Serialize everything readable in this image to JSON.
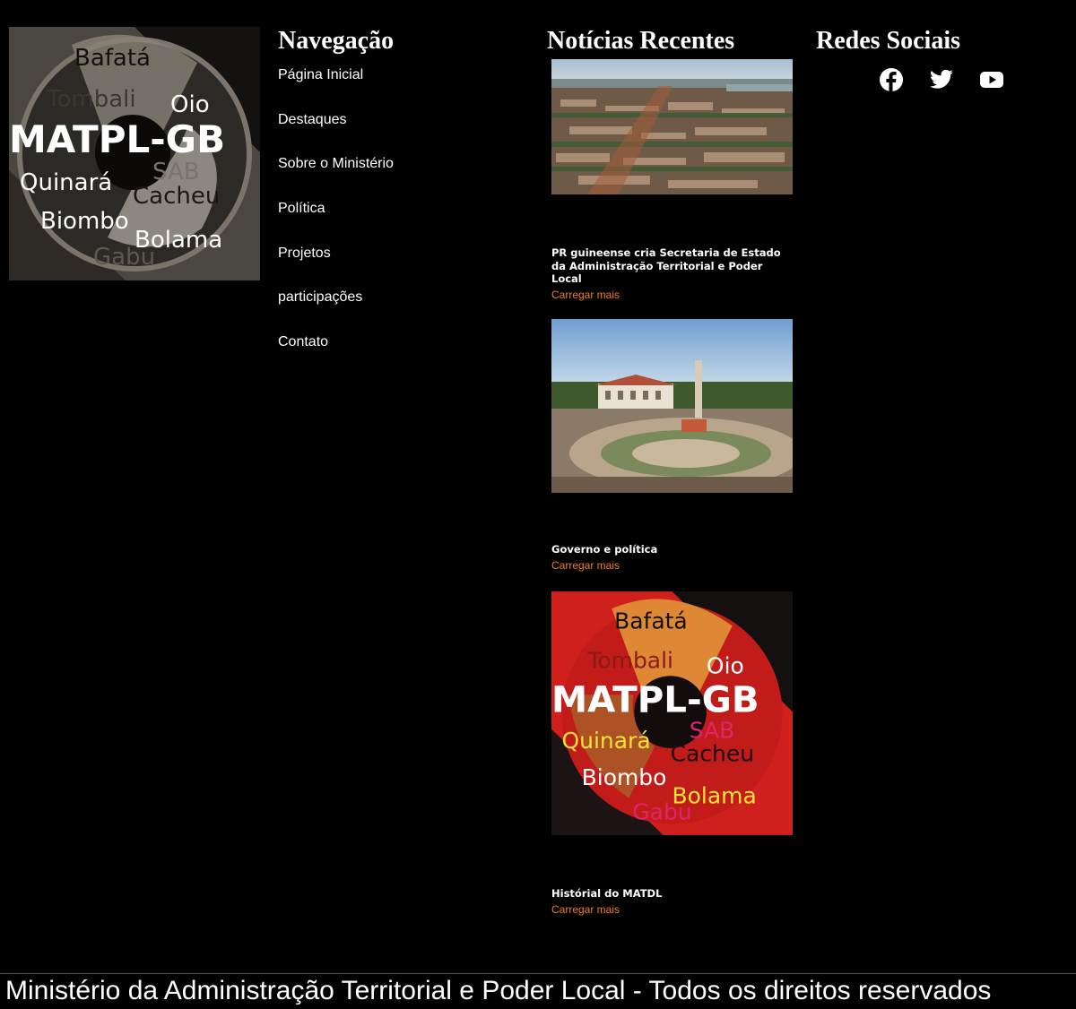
{
  "logo": {
    "brand": "MATPL-GB",
    "regions": [
      "Bafatá",
      "Tombali",
      "Oio",
      "SAB",
      "Quinará",
      "Cacheu",
      "Biombo",
      "Bolama",
      "Gabu"
    ]
  },
  "nav": {
    "heading": "Navegação",
    "items": [
      {
        "label": "Página Inicial"
      },
      {
        "label": "Destaques"
      },
      {
        "label": "Sobre o Ministério"
      },
      {
        "label": "Política"
      },
      {
        "label": "Projetos"
      },
      {
        "label": "participações"
      },
      {
        "label": "Contato"
      }
    ]
  },
  "news": {
    "heading": "Notícias Recentes",
    "items": [
      {
        "title": "PR guineense cria Secretaria de Estado da Administração Territorial e Poder Local",
        "more": "Carregar mais",
        "image": "aerial-city-photo"
      },
      {
        "title": "Governo e política",
        "more": "Carregar mais",
        "image": "government-palace-square-photo"
      },
      {
        "title": "Histórial do MATDL",
        "more": "Carregar mais",
        "image": "matpl-gb-logo-red"
      }
    ]
  },
  "social": {
    "heading": "Redes Sociais",
    "icons": [
      "facebook-icon",
      "twitter-icon",
      "youtube-icon"
    ]
  },
  "footer": {
    "text": "Ministério da Administração Territorial e Poder Local - Todos os direitos reservados"
  },
  "colors": {
    "background": "#000000",
    "link_accent": "#f07f14",
    "logo_red": "#d0201e"
  }
}
